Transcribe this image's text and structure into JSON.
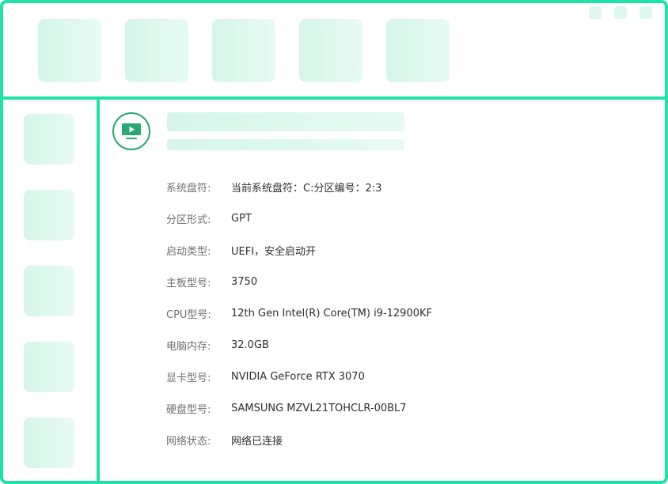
{
  "colors": {
    "accent_border": "#1fe2a8",
    "placeholder_fill": "#d6f6ea",
    "icon_green": "#2aa876",
    "label_text": "#6f6f6f",
    "value_text": "#2e2e2e"
  },
  "icons": {
    "header": "monitor-play-icon"
  },
  "info": [
    {
      "label": "系统盘符:",
      "value": "当前系统盘符：C:分区编号：2:3"
    },
    {
      "label": "分区形式:",
      "value": "GPT"
    },
    {
      "label": "启动类型:",
      "value": "UEFI，安全启动开"
    },
    {
      "label": "主板型号:",
      "value": "3750"
    },
    {
      "label": "CPU型号:",
      "value": "12th Gen Intel(R) Core(TM) i9-12900KF"
    },
    {
      "label": "电脑内存:",
      "value": "32.0GB"
    },
    {
      "label": "显卡型号:",
      "value": "NVIDIA GeForce RTX 3070"
    },
    {
      "label": "硬盘型号:",
      "value": "SAMSUNG MZVL21TOHCLR-00BL7"
    },
    {
      "label": "网络状态:",
      "value": "网络已连接"
    }
  ]
}
